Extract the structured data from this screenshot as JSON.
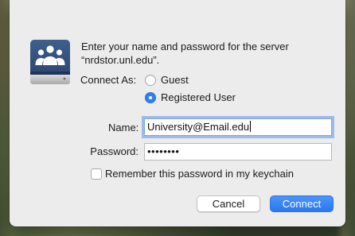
{
  "dialog": {
    "message": "Enter your name and password for the server “nrdstor.unl.edu”.",
    "server_icon": "server-users-icon",
    "connect_as_label": "Connect As:",
    "options": [
      {
        "label": "Guest",
        "selected": false
      },
      {
        "label": "Registered User",
        "selected": true
      }
    ],
    "name_label": "Name:",
    "name_value": "University@Email.edu",
    "password_label": "Password:",
    "password_masked": "••••••••",
    "remember_label": "Remember this password in my keychain",
    "remember_checked": false,
    "cancel_label": "Cancel",
    "connect_label": "Connect"
  },
  "colors": {
    "accent": "#2f7ef7",
    "dialog_bg": "#ececec",
    "focus_ring": "#5c91e6"
  }
}
